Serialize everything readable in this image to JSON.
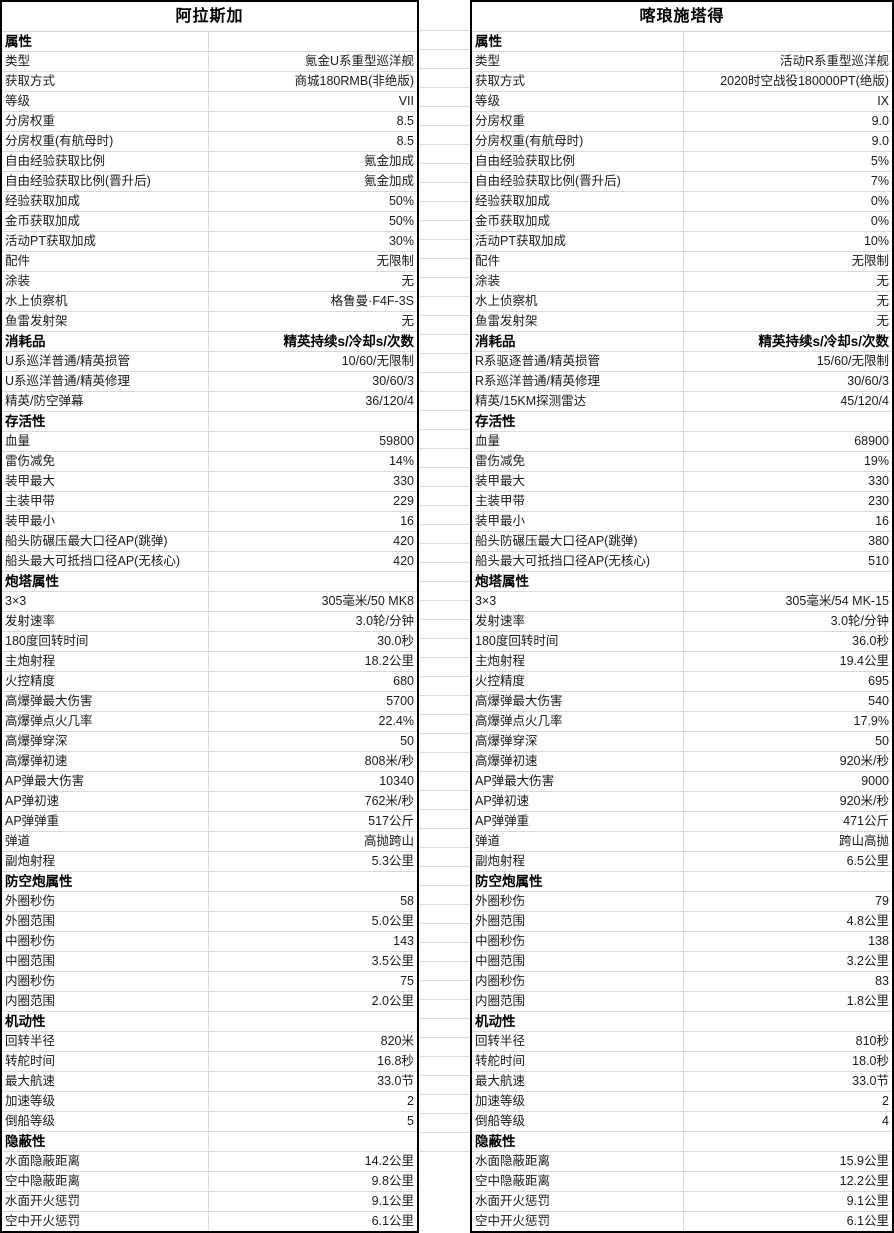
{
  "tables": [
    {
      "title": "阿拉斯加",
      "rows": [
        {
          "type": "section",
          "label": "属性",
          "value": ""
        },
        {
          "type": "data",
          "label": "类型",
          "value": "氪金U系重型巡洋舰"
        },
        {
          "type": "data",
          "label": "获取方式",
          "value": "商城180RMB(非绝版)"
        },
        {
          "type": "data",
          "label": "等级",
          "value": "VII"
        },
        {
          "type": "data",
          "label": "分房权重",
          "value": "8.5"
        },
        {
          "type": "data",
          "label": "分房权重(有航母时)",
          "value": "8.5"
        },
        {
          "type": "data",
          "label": "自由经验获取比例",
          "value": "氪金加成"
        },
        {
          "type": "data",
          "label": "自由经验获取比例(晋升后)",
          "value": "氪金加成"
        },
        {
          "type": "data",
          "label": "经验获取加成",
          "value": "50%"
        },
        {
          "type": "data",
          "label": "金币获取加成",
          "value": "50%"
        },
        {
          "type": "data",
          "label": "活动PT获取加成",
          "value": "30%"
        },
        {
          "type": "data",
          "label": "配件",
          "value": "无限制"
        },
        {
          "type": "data",
          "label": "涂装",
          "value": "无"
        },
        {
          "type": "data",
          "label": "水上侦察机",
          "value": "格鲁曼·F4F-3S"
        },
        {
          "type": "data",
          "label": "鱼雷发射架",
          "value": "无"
        },
        {
          "type": "section",
          "label": "消耗品",
          "value": "精英持续s/冷却s/次数"
        },
        {
          "type": "data",
          "label": "U系巡洋普通/精英损管",
          "value": "10/60/无限制"
        },
        {
          "type": "data",
          "label": "U系巡洋普通/精英修理",
          "value": "30/60/3"
        },
        {
          "type": "data",
          "label": "精英/防空弹幕",
          "value": "36/120/4"
        },
        {
          "type": "section",
          "label": "存活性",
          "value": ""
        },
        {
          "type": "data",
          "label": "血量",
          "value": "59800"
        },
        {
          "type": "data",
          "label": "雷伤减免",
          "value": "14%"
        },
        {
          "type": "data",
          "label": "装甲最大",
          "value": "330"
        },
        {
          "type": "data",
          "label": "主装甲带",
          "value": "229"
        },
        {
          "type": "data",
          "label": "装甲最小",
          "value": "16"
        },
        {
          "type": "data",
          "label": "船头防碾压最大口径AP(跳弹)",
          "value": "420"
        },
        {
          "type": "data",
          "label": "船头最大可抵挡口径AP(无核心)",
          "value": "420"
        },
        {
          "type": "section",
          "label": "炮塔属性",
          "value": ""
        },
        {
          "type": "data",
          "label": "3×3",
          "value": "305毫米/50 MK8"
        },
        {
          "type": "data",
          "label": "发射速率",
          "value": "3.0轮/分钟"
        },
        {
          "type": "data",
          "label": "180度回转时间",
          "value": "30.0秒"
        },
        {
          "type": "data",
          "label": "主炮射程",
          "value": "18.2公里"
        },
        {
          "type": "data",
          "label": "火控精度",
          "value": "680"
        },
        {
          "type": "data",
          "label": "高爆弹最大伤害",
          "value": "5700"
        },
        {
          "type": "data",
          "label": "高爆弹点火几率",
          "value": "22.4%"
        },
        {
          "type": "data",
          "label": "高爆弹穿深",
          "value": "50"
        },
        {
          "type": "data",
          "label": "高爆弹初速",
          "value": "808米/秒"
        },
        {
          "type": "data",
          "label": "AP弹最大伤害",
          "value": "10340"
        },
        {
          "type": "data",
          "label": "AP弹初速",
          "value": "762米/秒"
        },
        {
          "type": "data",
          "label": "AP弹弹重",
          "value": "517公斤"
        },
        {
          "type": "data",
          "label": "弹道",
          "value": "高抛跨山"
        },
        {
          "type": "data",
          "label": "副炮射程",
          "value": "5.3公里"
        },
        {
          "type": "section",
          "label": "防空炮属性",
          "value": ""
        },
        {
          "type": "data",
          "label": "外圈秒伤",
          "value": "58"
        },
        {
          "type": "data",
          "label": "外圈范围",
          "value": "5.0公里"
        },
        {
          "type": "data",
          "label": "中圈秒伤",
          "value": "143"
        },
        {
          "type": "data",
          "label": "中圈范围",
          "value": "3.5公里"
        },
        {
          "type": "data",
          "label": "内圈秒伤",
          "value": "75"
        },
        {
          "type": "data",
          "label": "内圈范围",
          "value": "2.0公里"
        },
        {
          "type": "section",
          "label": "机动性",
          "value": ""
        },
        {
          "type": "data",
          "label": "回转半径",
          "value": "820米"
        },
        {
          "type": "data",
          "label": "转舵时间",
          "value": "16.8秒"
        },
        {
          "type": "data",
          "label": "最大航速",
          "value": "33.0节"
        },
        {
          "type": "data",
          "label": "加速等级",
          "value": "2"
        },
        {
          "type": "data",
          "label": "倒船等级",
          "value": "5"
        },
        {
          "type": "section",
          "label": "隐蔽性",
          "value": ""
        },
        {
          "type": "data",
          "label": "水面隐蔽距离",
          "value": "14.2公里"
        },
        {
          "type": "data",
          "label": "空中隐蔽距离",
          "value": "9.8公里"
        },
        {
          "type": "data",
          "label": "水面开火惩罚",
          "value": "9.1公里"
        },
        {
          "type": "data",
          "label": "空中开火惩罚",
          "value": "6.1公里"
        }
      ]
    },
    {
      "title": "喀琅施塔得",
      "rows": [
        {
          "type": "section",
          "label": "属性",
          "value": ""
        },
        {
          "type": "data",
          "label": "类型",
          "value": "活动R系重型巡洋舰"
        },
        {
          "type": "data",
          "label": "获取方式",
          "value": "2020时空战役180000PT(绝版)"
        },
        {
          "type": "data",
          "label": "等级",
          "value": "IX"
        },
        {
          "type": "data",
          "label": "分房权重",
          "value": "9.0"
        },
        {
          "type": "data",
          "label": "分房权重(有航母时)",
          "value": "9.0"
        },
        {
          "type": "data",
          "label": "自由经验获取比例",
          "value": "5%"
        },
        {
          "type": "data",
          "label": "自由经验获取比例(晋升后)",
          "value": "7%"
        },
        {
          "type": "data",
          "label": "经验获取加成",
          "value": "0%"
        },
        {
          "type": "data",
          "label": "金币获取加成",
          "value": "0%"
        },
        {
          "type": "data",
          "label": "活动PT获取加成",
          "value": "10%"
        },
        {
          "type": "data",
          "label": "配件",
          "value": "无限制"
        },
        {
          "type": "data",
          "label": "涂装",
          "value": "无"
        },
        {
          "type": "data",
          "label": "水上侦察机",
          "value": "无"
        },
        {
          "type": "data",
          "label": "鱼雷发射架",
          "value": "无"
        },
        {
          "type": "section",
          "label": "消耗品",
          "value": "精英持续s/冷却s/次数"
        },
        {
          "type": "data",
          "label": "R系驱逐普通/精英损管",
          "value": "15/60/无限制"
        },
        {
          "type": "data",
          "label": "R系巡洋普通/精英修理",
          "value": "30/60/3"
        },
        {
          "type": "data",
          "label": "精英/15KM探测雷达",
          "value": "45/120/4"
        },
        {
          "type": "section",
          "label": "存活性",
          "value": ""
        },
        {
          "type": "data",
          "label": "血量",
          "value": "68900"
        },
        {
          "type": "data",
          "label": "雷伤减免",
          "value": "19%"
        },
        {
          "type": "data",
          "label": "装甲最大",
          "value": "330"
        },
        {
          "type": "data",
          "label": "主装甲带",
          "value": "230"
        },
        {
          "type": "data",
          "label": "装甲最小",
          "value": "16"
        },
        {
          "type": "data",
          "label": "船头防碾压最大口径AP(跳弹)",
          "value": "380"
        },
        {
          "type": "data",
          "label": "船头最大可抵挡口径AP(无核心)",
          "value": "510"
        },
        {
          "type": "section",
          "label": "炮塔属性",
          "value": ""
        },
        {
          "type": "data",
          "label": "3×3",
          "value": "305毫米/54 MK-15"
        },
        {
          "type": "data",
          "label": "发射速率",
          "value": "3.0轮/分钟"
        },
        {
          "type": "data",
          "label": "180度回转时间",
          "value": "36.0秒"
        },
        {
          "type": "data",
          "label": "主炮射程",
          "value": "19.4公里"
        },
        {
          "type": "data",
          "label": "火控精度",
          "value": "695"
        },
        {
          "type": "data",
          "label": "高爆弹最大伤害",
          "value": "540"
        },
        {
          "type": "data",
          "label": "高爆弹点火几率",
          "value": "17.9%"
        },
        {
          "type": "data",
          "label": "高爆弹穿深",
          "value": "50"
        },
        {
          "type": "data",
          "label": "高爆弹初速",
          "value": "920米/秒"
        },
        {
          "type": "data",
          "label": "AP弹最大伤害",
          "value": "9000"
        },
        {
          "type": "data",
          "label": "AP弹初速",
          "value": "920米/秒"
        },
        {
          "type": "data",
          "label": "AP弹弹重",
          "value": "471公斤"
        },
        {
          "type": "data",
          "label": "弹道",
          "value": "跨山高抛"
        },
        {
          "type": "data",
          "label": "副炮射程",
          "value": "6.5公里"
        },
        {
          "type": "section",
          "label": "防空炮属性",
          "value": ""
        },
        {
          "type": "data",
          "label": "外圈秒伤",
          "value": "79"
        },
        {
          "type": "data",
          "label": "外圈范围",
          "value": "4.8公里"
        },
        {
          "type": "data",
          "label": "中圈秒伤",
          "value": "138"
        },
        {
          "type": "data",
          "label": "中圈范围",
          "value": "3.2公里"
        },
        {
          "type": "data",
          "label": "内圈秒伤",
          "value": "83"
        },
        {
          "type": "data",
          "label": "内圈范围",
          "value": "1.8公里"
        },
        {
          "type": "section",
          "label": "机动性",
          "value": ""
        },
        {
          "type": "data",
          "label": "回转半径",
          "value": "810秒"
        },
        {
          "type": "data",
          "label": "转舵时间",
          "value": "18.0秒"
        },
        {
          "type": "data",
          "label": "最大航速",
          "value": "33.0节"
        },
        {
          "type": "data",
          "label": "加速等级",
          "value": "2"
        },
        {
          "type": "data",
          "label": "倒船等级",
          "value": "4"
        },
        {
          "type": "section",
          "label": "隐蔽性",
          "value": ""
        },
        {
          "type": "data",
          "label": "水面隐蔽距离",
          "value": "15.9公里"
        },
        {
          "type": "data",
          "label": "空中隐蔽距离",
          "value": "12.2公里"
        },
        {
          "type": "data",
          "label": "水面开火惩罚",
          "value": "9.1公里"
        },
        {
          "type": "data",
          "label": "空中开火惩罚",
          "value": "6.1公里"
        }
      ]
    }
  ],
  "colors": {
    "grid_line": "#d9d9d9",
    "outer_border": "#000000",
    "text": "#1a1a1a",
    "background": "#ffffff"
  }
}
